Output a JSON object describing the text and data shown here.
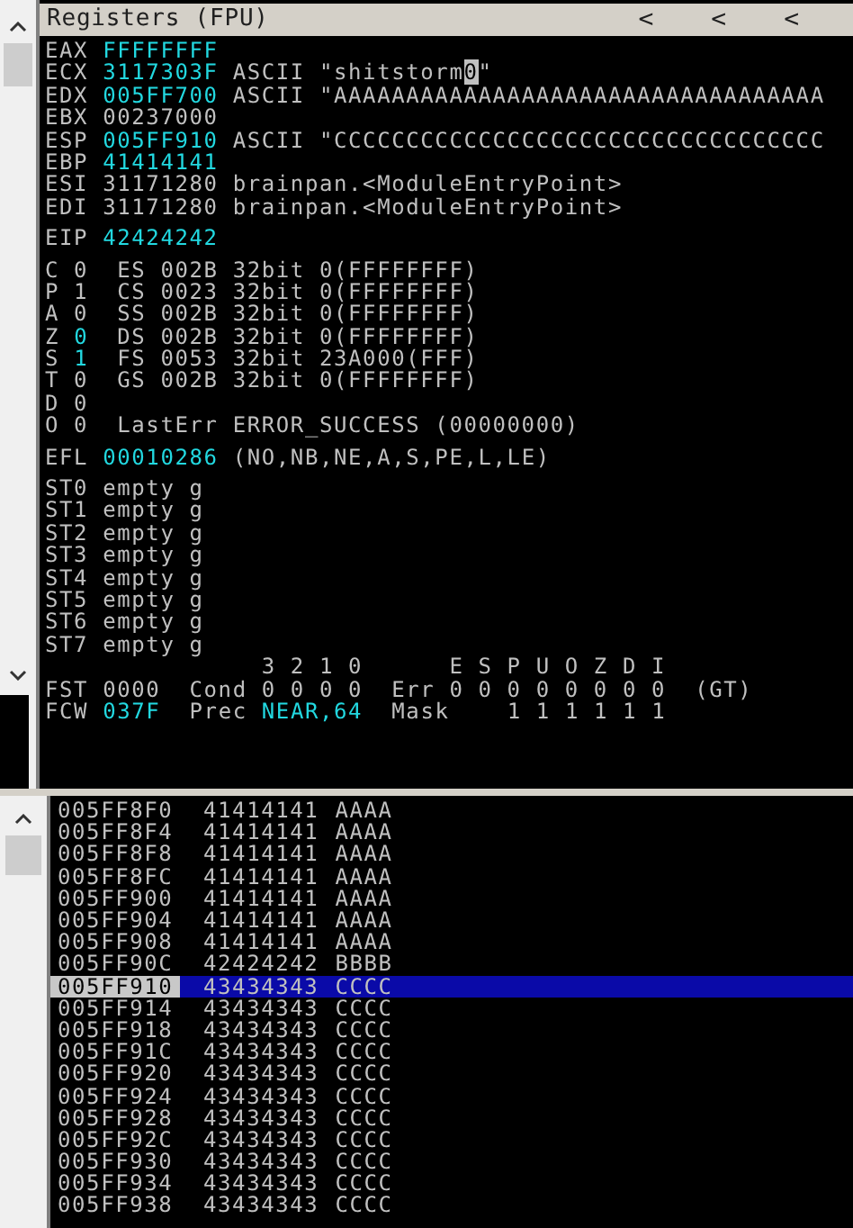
{
  "registers_panel": {
    "title": "Registers (FPU)",
    "title_buttons": [
      "<",
      "<",
      "<"
    ],
    "groups": [
      [
        [
          {
            "text": "EAX "
          },
          {
            "text": "FFFFFFFF",
            "changed": true
          }
        ],
        [
          {
            "text": "ECX "
          },
          {
            "text": "3117303F",
            "changed": true
          },
          {
            "text": " ASCII \"shitstorm"
          },
          {
            "text": "0",
            "boxed": true
          },
          {
            "text": "\""
          }
        ],
        [
          {
            "text": "EDX "
          },
          {
            "text": "005FF700",
            "changed": true
          },
          {
            "text": " ASCII \"AAAAAAAAAAAAAAAAAAAAAAAAAAAAAAAAAA"
          }
        ],
        [
          {
            "text": "EBX 00237000"
          }
        ],
        [
          {
            "text": "ESP "
          },
          {
            "text": "005FF910",
            "changed": true
          },
          {
            "text": " ASCII \"CCCCCCCCCCCCCCCCCCCCCCCCCCCCCCCCCC"
          }
        ],
        [
          {
            "text": "EBP "
          },
          {
            "text": "41414141",
            "changed": true
          }
        ],
        [
          {
            "text": "ESI 31171280 brainpan.<ModuleEntryPoint>"
          }
        ],
        [
          {
            "text": "EDI 31171280 brainpan.<ModuleEntryPoint>"
          }
        ]
      ],
      [
        [
          {
            "text": "EIP "
          },
          {
            "text": "42424242",
            "changed": true
          }
        ]
      ],
      [
        [
          {
            "text": "C 0  ES 002B 32bit 0(FFFFFFFF)"
          }
        ],
        [
          {
            "text": "P 1  CS 0023 32bit 0(FFFFFFFF)"
          }
        ],
        [
          {
            "text": "A 0  SS 002B 32bit 0(FFFFFFFF)"
          }
        ],
        [
          {
            "text": "Z "
          },
          {
            "text": "0",
            "changed": true
          },
          {
            "text": "  DS 002B 32bit 0(FFFFFFFF)"
          }
        ],
        [
          {
            "text": "S "
          },
          {
            "text": "1",
            "changed": true
          },
          {
            "text": "  FS 0053 32bit 23A000(FFF)"
          }
        ],
        [
          {
            "text": "T 0  GS 002B 32bit 0(FFFFFFFF)"
          }
        ],
        [
          {
            "text": "D 0"
          }
        ],
        [
          {
            "text": "O 0  LastErr ERROR_SUCCESS (00000000)"
          }
        ]
      ],
      [
        [
          {
            "text": "EFL "
          },
          {
            "text": "00010286",
            "changed": true
          },
          {
            "text": " (NO,NB,NE,A,S,PE,L,LE)"
          }
        ]
      ],
      [
        [
          {
            "text": "ST0 empty g"
          }
        ],
        [
          {
            "text": "ST1 empty g"
          }
        ],
        [
          {
            "text": "ST2 empty g"
          }
        ],
        [
          {
            "text": "ST3 empty g"
          }
        ],
        [
          {
            "text": "ST4 empty g"
          }
        ],
        [
          {
            "text": "ST5 empty g"
          }
        ],
        [
          {
            "text": "ST6 empty g"
          }
        ],
        [
          {
            "text": "ST7 empty g"
          }
        ],
        [
          {
            "text": "               3 2 1 0      E S P U O Z D I"
          }
        ],
        [
          {
            "text": "FST 0000  Cond 0 0 0 0  Err 0 0 0 0 0 0 0 0  (GT)"
          }
        ],
        [
          {
            "text": "FCW "
          },
          {
            "text": "037F",
            "changed": true
          },
          {
            "text": "  Prec "
          },
          {
            "text": "NEAR,64",
            "changed": true
          },
          {
            "text": "  Mask    1 1 1 1 1 1"
          }
        ]
      ]
    ]
  },
  "stack_panel": {
    "rows": [
      {
        "address": "005FF8F0",
        "value": "41414141",
        "ascii": "AAAA",
        "selected": false
      },
      {
        "address": "005FF8F4",
        "value": "41414141",
        "ascii": "AAAA",
        "selected": false
      },
      {
        "address": "005FF8F8",
        "value": "41414141",
        "ascii": "AAAA",
        "selected": false
      },
      {
        "address": "005FF8FC",
        "value": "41414141",
        "ascii": "AAAA",
        "selected": false
      },
      {
        "address": "005FF900",
        "value": "41414141",
        "ascii": "AAAA",
        "selected": false
      },
      {
        "address": "005FF904",
        "value": "41414141",
        "ascii": "AAAA",
        "selected": false
      },
      {
        "address": "005FF908",
        "value": "41414141",
        "ascii": "AAAA",
        "selected": false
      },
      {
        "address": "005FF90C",
        "value": "42424242",
        "ascii": "BBBB",
        "selected": false
      },
      {
        "address": "005FF910",
        "value": "43434343",
        "ascii": "CCCC",
        "selected": true
      },
      {
        "address": "005FF914",
        "value": "43434343",
        "ascii": "CCCC",
        "selected": false
      },
      {
        "address": "005FF918",
        "value": "43434343",
        "ascii": "CCCC",
        "selected": false
      },
      {
        "address": "005FF91C",
        "value": "43434343",
        "ascii": "CCCC",
        "selected": false
      },
      {
        "address": "005FF920",
        "value": "43434343",
        "ascii": "CCCC",
        "selected": false
      },
      {
        "address": "005FF924",
        "value": "43434343",
        "ascii": "CCCC",
        "selected": false
      },
      {
        "address": "005FF928",
        "value": "43434343",
        "ascii": "CCCC",
        "selected": false
      },
      {
        "address": "005FF92C",
        "value": "43434343",
        "ascii": "CCCC",
        "selected": false
      },
      {
        "address": "005FF930",
        "value": "43434343",
        "ascii": "CCCC",
        "selected": false
      },
      {
        "address": "005FF934",
        "value": "43434343",
        "ascii": "CCCC",
        "selected": false
      },
      {
        "address": "005FF938",
        "value": "43434343",
        "ascii": "CCCC",
        "selected": false
      }
    ]
  }
}
